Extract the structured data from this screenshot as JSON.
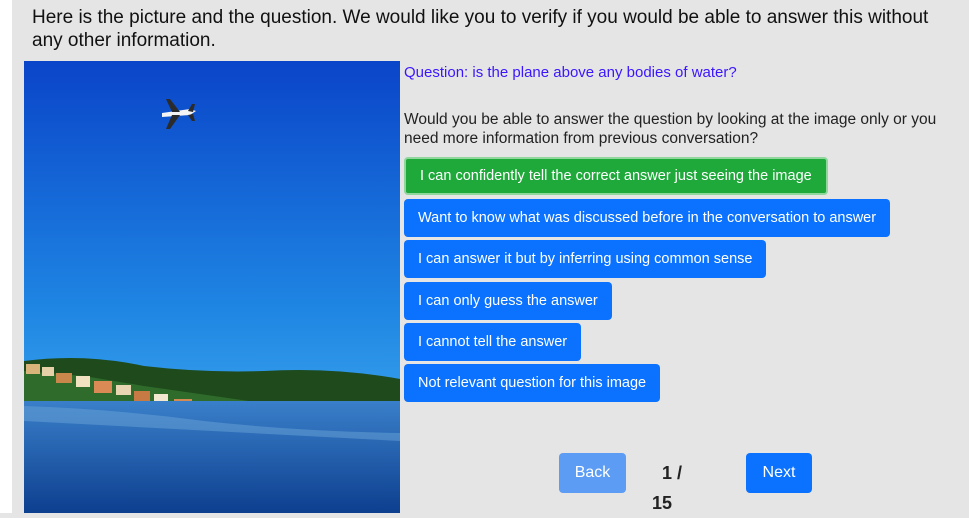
{
  "instructions": "Here is the picture and the question. We would like you to verify if you would be able to answer this without any other information.",
  "question": "Question: is the plane above any bodies of water?",
  "prompt": "Would you be able to answer the question by looking at the image only or you need more information from previous conversation?",
  "options": [
    {
      "label": "I can confidently tell the correct answer just seeing the image",
      "selected": true
    },
    {
      "label": "Want to know what was discussed before in the conversation to answer",
      "selected": false
    },
    {
      "label": "I can answer it but by inferring using common sense",
      "selected": false
    },
    {
      "label": "I can only guess the answer",
      "selected": false
    },
    {
      "label": "I cannot tell the answer",
      "selected": false
    },
    {
      "label": "Not relevant question for this image",
      "selected": false
    }
  ],
  "nav": {
    "back_label": "Back",
    "next_label": "Next",
    "page_current": "1 /",
    "page_total": "15"
  },
  "colors": {
    "primary": "#0b72ff",
    "selected": "#1fa93a",
    "question": "#3b15ff",
    "back_disabled": "#5c9cf4"
  }
}
